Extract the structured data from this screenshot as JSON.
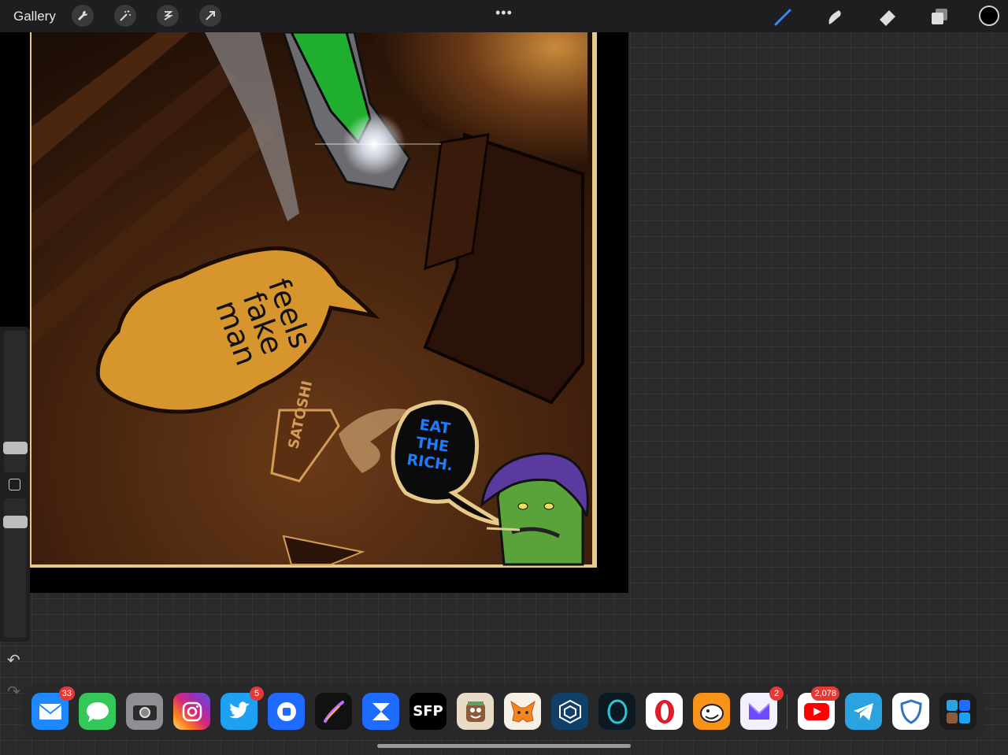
{
  "topbar": {
    "gallery_label": "Gallery",
    "more_label": "•••",
    "left_tools": [
      "wrench-icon",
      "magic-wand-icon",
      "selection-icon",
      "transform-arrow-icon"
    ],
    "right_tools": [
      "brush-icon",
      "smudge-icon",
      "eraser-icon",
      "layers-icon"
    ],
    "current_color": "#000000",
    "accent_color": "#2f8bff"
  },
  "artwork": {
    "speech_bubble_left": [
      "feels",
      "fake",
      "man"
    ],
    "sign_text": "SATOSHI",
    "speech_bubble_right": [
      "EAT",
      "THE",
      "RICH."
    ]
  },
  "sidebar": {
    "undo_icon": "undo-icon",
    "redo_icon": "redo-icon"
  },
  "dock": {
    "apps": [
      {
        "name": "Mail",
        "badge": "33",
        "color": "#1e88ff"
      },
      {
        "name": "Messages",
        "badge": "",
        "color": "#34c759"
      },
      {
        "name": "Camera",
        "badge": "",
        "color": "#8e8e93"
      },
      {
        "name": "Instagram",
        "badge": "",
        "color": "#d6249f"
      },
      {
        "name": "Twitter",
        "badge": "5",
        "color": "#1da1f2"
      },
      {
        "name": "Blockfolio",
        "badge": "",
        "color": "#1f6bff"
      },
      {
        "name": "Procreate",
        "badge": "",
        "color": "#111111"
      },
      {
        "name": "Crypto",
        "badge": "",
        "color": "#1e6bff"
      },
      {
        "name": "SFP",
        "badge": "",
        "color": "#000000"
      },
      {
        "name": "Toon",
        "badge": "",
        "color": "#e8dcc8"
      },
      {
        "name": "MetaMask",
        "badge": "",
        "color": "#f6f0e6"
      },
      {
        "name": "Crypto.com",
        "badge": "",
        "color": "#103f68"
      },
      {
        "name": "Opera Touch",
        "badge": "",
        "color": "#0b1a22"
      },
      {
        "name": "Opera",
        "badge": "",
        "color": "#ffffff"
      },
      {
        "name": "Rainbow",
        "badge": "",
        "color": "#f7931a"
      },
      {
        "name": "Proton Mail",
        "badge": "2",
        "color": "#f3f0ff"
      },
      {
        "name": "YouTube",
        "badge": "2,078",
        "color": "#ffffff"
      },
      {
        "name": "Telegram",
        "badge": "",
        "color": "#2aa3e0"
      },
      {
        "name": "Trust Wallet",
        "badge": "",
        "color": "#ffffff"
      },
      {
        "name": "App Library",
        "badge": "",
        "color": "#1c1c1e"
      }
    ]
  }
}
